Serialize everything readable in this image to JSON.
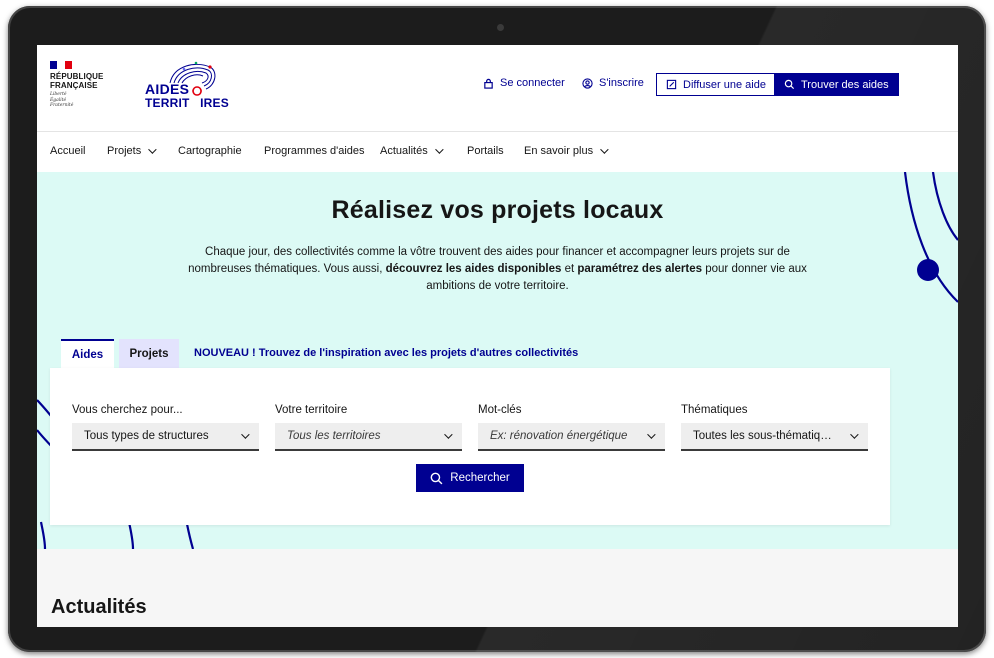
{
  "header": {
    "republic_lines": [
      "RÉPUBLIQUE",
      "FRANÇAISE"
    ],
    "motto_lines": [
      "Liberté",
      "Égalité",
      "Fraternité"
    ],
    "logo_word1": "AIDES",
    "logo_word2": "TERRIT   IRES",
    "login_label": "Se connecter",
    "login_icon": "lock-icon",
    "signup_label": "S'inscrire",
    "signup_icon": "user-circle-icon",
    "publish_label": "Diffuser une aide",
    "publish_icon": "edit-square-icon",
    "find_label": "Trouver des aides",
    "find_icon": "search-icon"
  },
  "nav": {
    "items": [
      {
        "label": "Accueil",
        "dropdown": false
      },
      {
        "label": "Projets",
        "dropdown": true
      },
      {
        "label": "Cartographie",
        "dropdown": false
      },
      {
        "label": "Programmes d'aides",
        "dropdown": false
      },
      {
        "label": "Actualités",
        "dropdown": true
      },
      {
        "label": "Portails",
        "dropdown": false
      },
      {
        "label": "En savoir plus",
        "dropdown": true
      }
    ]
  },
  "hero": {
    "title": "Réalisez vos projets locaux",
    "text_part1": "Chaque jour, des collectivités comme la vôtre trouvent des aides pour financer et accompagner leurs projets sur de nombreuses thématiques. Vous aussi, ",
    "text_bold1": "découvrez les aides disponibles",
    "text_part2": " et ",
    "text_bold2": "paramétrez des alertes",
    "text_part3": " pour donner vie aux ambitions de votre territoire."
  },
  "search": {
    "tabs": [
      {
        "label": "Aides",
        "active": true
      },
      {
        "label": "Projets",
        "active": false
      }
    ],
    "announcement": "NOUVEAU ! Trouvez de l'inspiration avec les projets d'autres collectivités",
    "fields": [
      {
        "label": "Vous cherchez pour...",
        "value": "Tous types de structures",
        "placeholder": false
      },
      {
        "label": "Votre territoire",
        "value": "Tous les territoires",
        "placeholder": true
      },
      {
        "label": "Mot-clés",
        "value": "Ex: rénovation énergétique",
        "placeholder": true
      },
      {
        "label": "Thématiques",
        "value": "Toutes les sous-thématiques",
        "placeholder": false
      }
    ],
    "button_label": "Rechercher"
  },
  "news": {
    "title": "Actualités"
  },
  "colors": {
    "brand_blue": "#000091",
    "hero_bg": "#dcfaf5",
    "tab_inactive_bg": "#e3e3fd",
    "flag_blue": "#000091",
    "flag_red": "#e1000f"
  }
}
